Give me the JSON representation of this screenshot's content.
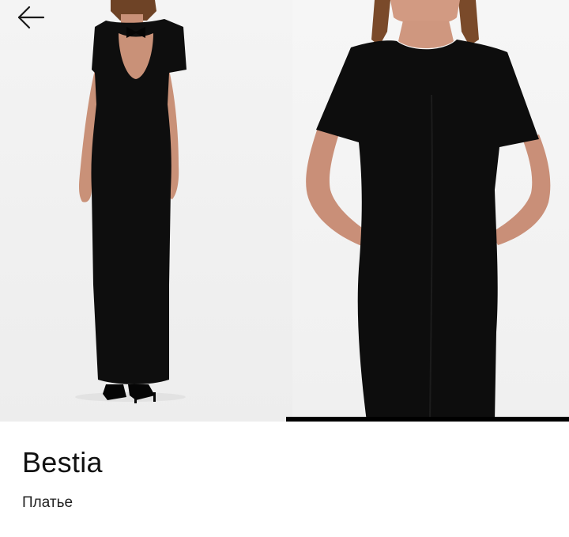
{
  "navigation": {
    "back_icon": "arrow-left-icon"
  },
  "gallery": {
    "images": [
      {
        "name": "product-photo-back",
        "description_icon": "dress-back-view"
      },
      {
        "name": "product-photo-front",
        "description_icon": "dress-front-view"
      }
    ],
    "progress": 0.5,
    "colors": {
      "background": "#f2f2f2",
      "indicator": "#000000",
      "dress": "#0d0d0d",
      "skin": "#c98f78",
      "hair": "#7a4a2a"
    }
  },
  "product": {
    "brand": "Bestia",
    "category": "Платье"
  }
}
